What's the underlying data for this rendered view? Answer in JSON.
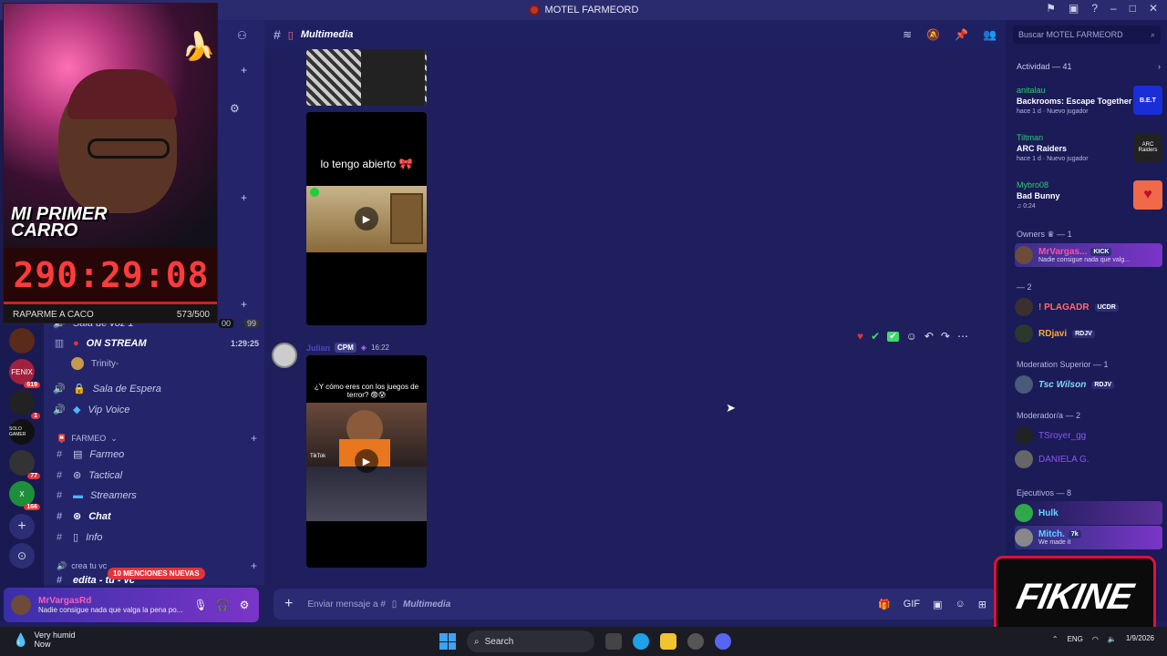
{
  "window": {
    "title": "MOTEL FARMEORD"
  },
  "servers": [
    {
      "label": "",
      "badge": ""
    },
    {
      "label": "",
      "badge": ""
    },
    {
      "label": "FENIX",
      "badge": "619"
    },
    {
      "label": "",
      "badge": "1"
    },
    {
      "label": "SOLO GAMER",
      "badge": ""
    },
    {
      "label": "",
      "badge": "77"
    },
    {
      "label": "X",
      "badge": "166"
    }
  ],
  "overlay": {
    "title": "MI PRIMER CARRO",
    "timer": "290:29:08",
    "goal_label": "RAPARME A CACO",
    "goal_count": "573/500"
  },
  "sidebar": {
    "voice_counts": [
      "00",
      "99"
    ],
    "partial_channel": "Sala de voz 1",
    "on_stream": {
      "label": "ON STREAM",
      "time": "1:29:25",
      "user": "Trinity-"
    },
    "channels_voice": [
      "Sala de Espera",
      "Vip Voice"
    ],
    "category_farmeo": "FARMEO",
    "text_channels": [
      "Farmeo",
      "Tactical",
      "Streamers",
      "Chat",
      "Info"
    ],
    "category_crea": "crea tu vc",
    "last_channel": "edita - tu - vc",
    "mentions_pill": "10 MENCIONES NUEVAS"
  },
  "user_panel": {
    "name": "MrVargasRd",
    "status": "Nadie consigue nada que valga la pena po..."
  },
  "header": {
    "channel": "Multimedia"
  },
  "messages": {
    "media1_caption": "lo tengo abierto 🎀",
    "msg_author": "Julian",
    "msg_tag": "CPM",
    "msg_time": "16:22",
    "media2_caption": "¿Y cómo eres con los juegos de terror? 😨😰",
    "media2_watermark": "TikTok"
  },
  "composer": {
    "placeholder": "Enviar mensaje a #",
    "channel": "Multimedia"
  },
  "right_panel": {
    "search_placeholder": "Buscar MOTEL FARMEORD",
    "activity_header": "Actividad — 41",
    "activities": [
      {
        "user": "anitalau",
        "game": "Backrooms: Escape Together",
        "sub": "hace 1 d · Nuevo jugador",
        "thumb": "B.E.T",
        "color": "#1a2ed8"
      },
      {
        "user": "Tiltman",
        "game": "ARC Raiders",
        "sub": "hace 1 d · Nuevo jugador",
        "thumb": "ARC Raiders",
        "color": "#222222"
      },
      {
        "user": "Mybro08",
        "game": "Bad Bunny",
        "sub": "♫ 0:24",
        "thumb": "♥",
        "color": "#f06a4a"
      }
    ],
    "groups": [
      {
        "title": "Owners ♛ — 1"
      },
      {
        "title": "— 2"
      },
      {
        "title": "Moderation Superior — 1"
      },
      {
        "title": "Moderador/a — 2"
      },
      {
        "title": "Ejecutivos — 8"
      }
    ],
    "members": [
      {
        "name": "MrVargas...",
        "badge": "KICK",
        "status": "Nadie consigue nada que valg...",
        "color": "#ff4fa8"
      },
      {
        "name": "! PLAGADR",
        "badge": "UCDR",
        "status": "",
        "color": "#ff6b6b"
      },
      {
        "name": "RDjavi",
        "badge": "RDJV",
        "status": "",
        "color": "#ffa640"
      },
      {
        "name": "Tsc Wilson",
        "badge": "RDJV",
        "status": "",
        "color": "#7fd6ff"
      },
      {
        "name": "TSroyer_gg",
        "badge": "",
        "status": "",
        "color": "#8f55e8"
      },
      {
        "name": "DANIELA G.",
        "badge": "",
        "status": "",
        "color": "#8f55e8"
      },
      {
        "name": "Hulk",
        "badge": "",
        "status": "",
        "color": "#5fd4ff"
      },
      {
        "name": "Mitch.",
        "badge": "7k",
        "status": "We made it",
        "color": "#5fd4ff"
      }
    ]
  },
  "brand": {
    "logo_text": "FIKINE"
  },
  "taskbar": {
    "weather": "Very humid",
    "weather_sub": "Now",
    "search": "Search",
    "lang": "ENG",
    "date": "1/9/2026"
  }
}
